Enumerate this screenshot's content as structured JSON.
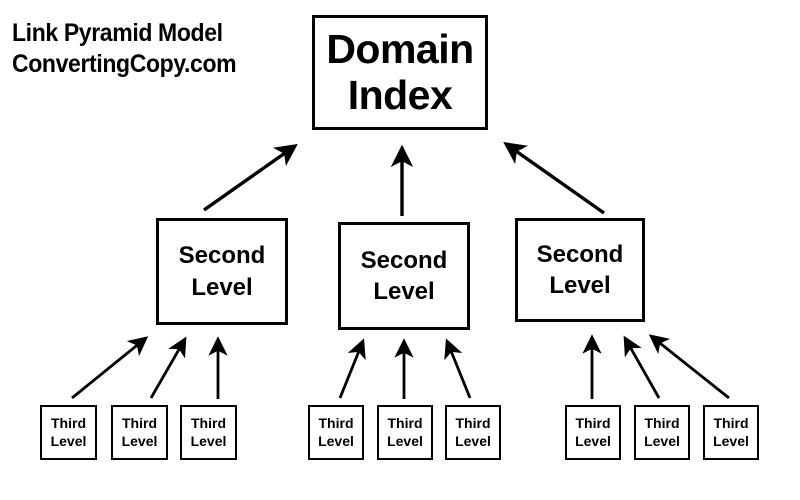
{
  "diagram": {
    "title_lines": [
      "Link Pyramid Model",
      "ConvertingCopy.com"
    ],
    "background_color": "#ffffff",
    "stroke_color": "#000000",
    "top_node": {
      "label": "Domain Index",
      "lines": [
        "Domain",
        "Index"
      ]
    },
    "second_level": [
      {
        "label": "Second Level",
        "lines": [
          "Second",
          "Level"
        ]
      },
      {
        "label": "Second Level",
        "lines": [
          "Second",
          "Level"
        ]
      },
      {
        "label": "Second Level",
        "lines": [
          "Second",
          "Level"
        ]
      }
    ],
    "third_level": [
      {
        "label": "Third Level",
        "lines": [
          "Third",
          "Level"
        ]
      },
      {
        "label": "Third Level",
        "lines": [
          "Third",
          "Level"
        ]
      },
      {
        "label": "Third Level",
        "lines": [
          "Third",
          "Level"
        ]
      },
      {
        "label": "Third Level",
        "lines": [
          "Third",
          "Level"
        ]
      },
      {
        "label": "Third Level",
        "lines": [
          "Third",
          "Level"
        ]
      },
      {
        "label": "Third Level",
        "lines": [
          "Third",
          "Level"
        ]
      },
      {
        "label": "Third Level",
        "lines": [
          "Third",
          "Level"
        ]
      },
      {
        "label": "Third Level",
        "lines": [
          "Third",
          "Level"
        ]
      },
      {
        "label": "Third Level",
        "lines": [
          "Third",
          "Level"
        ]
      }
    ]
  }
}
